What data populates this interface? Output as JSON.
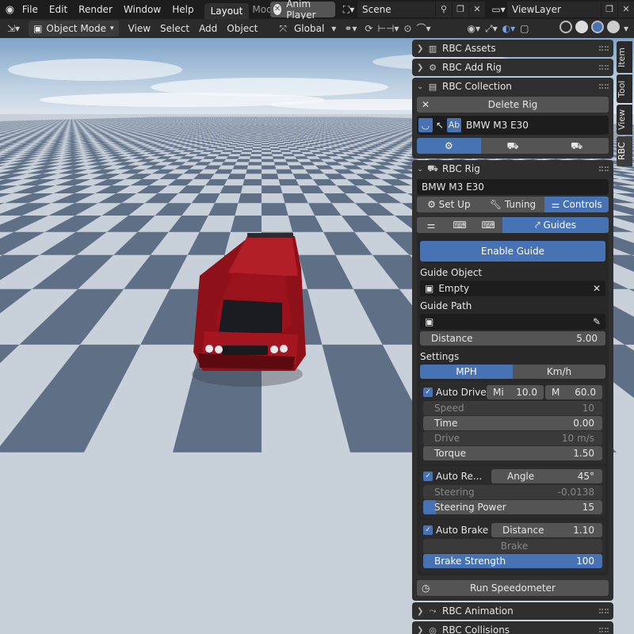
{
  "topbar": {
    "menus": [
      "File",
      "Edit",
      "Render",
      "Window",
      "Help"
    ],
    "workspace_tabs": [
      "Layout",
      "Mode"
    ],
    "anim_player": "Anim Player",
    "scene": "Scene",
    "view_layer": "ViewLayer"
  },
  "header": {
    "mode": "Object Mode",
    "menus": [
      "View",
      "Select",
      "Add",
      "Object"
    ],
    "transform_orientation": "Global"
  },
  "side_tabs": [
    "Item",
    "Tool",
    "View",
    "RBC"
  ],
  "panels": {
    "assets": "RBC Assets",
    "add_rig": "RBC Add Rig",
    "collection": {
      "title": "RBC Collection",
      "delete_rig": "Delete Rig",
      "rig_item": "BMW M3 E30"
    },
    "rig": {
      "title": "RBC Rig",
      "rig_name": "BMW M3 E30",
      "tabs": [
        "Set Up",
        "Tuning",
        "Controls"
      ],
      "subtabs_active": "Guides",
      "enable_guide": "Enable Guide",
      "guide_object_label": "Guide Object",
      "guide_object_value": "Empty",
      "guide_path_label": "Guide Path",
      "distance_label": "Distance",
      "distance_value": "5.00",
      "settings_label": "Settings",
      "units": [
        "MPH",
        "Km/h"
      ],
      "auto_drive": "Auto Drive",
      "mi_label": "Mi",
      "mi_value": "10.0",
      "m_label": "M",
      "m_value": "60.0",
      "speed_label": "Speed",
      "speed_value": "10",
      "time_label": "Time",
      "time_value": "0.00",
      "drive_label": "Drive",
      "drive_value": "10 m/s",
      "torque_label": "Torque",
      "torque_value": "1.50",
      "auto_re": "Auto Re...",
      "angle_label": "Angle",
      "angle_value": "45°",
      "steering_label": "Steering",
      "steering_value": "-0.0138",
      "steering_power_label": "Steering Power",
      "steering_power_value": "15",
      "steering_power_fill": 0.07,
      "auto_brake": "Auto Brake",
      "brake_distance_label": "Distance",
      "brake_distance_value": "1.10",
      "brake_label": "Brake",
      "brake_strength_label": "Brake Strength",
      "brake_strength_value": "100",
      "run_speedometer": "Run Speedometer"
    },
    "animation": "RBC Animation",
    "collisions": "RBC Collisions"
  },
  "colors": {
    "accent": "#4772b3",
    "car": "#a3151f"
  }
}
